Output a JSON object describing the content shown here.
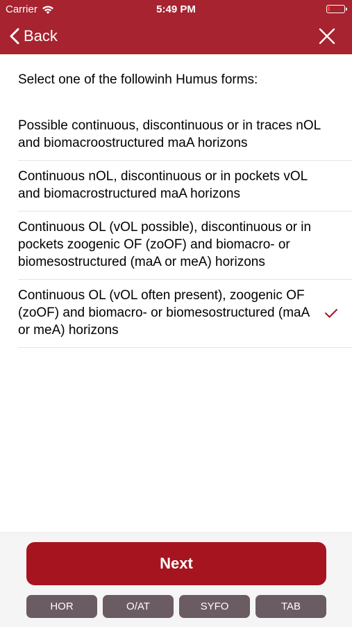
{
  "status_bar": {
    "carrier": "Carrier",
    "time": "5:49 PM",
    "battery_color": "#ff3b30"
  },
  "nav": {
    "back_label": "Back",
    "back_icon": "chevron-left-icon",
    "close_icon": "close-icon",
    "bar_color": "#a6232f"
  },
  "prompt": "Select one of the followinh Humus forms:",
  "options": [
    {
      "label": "Possible continuous, discontinuous or in traces nOL and biomacroostructured maA horizons",
      "selected": false
    },
    {
      "label": "Continuous nOL, discontinuous or in pockets vOL and biomacrostructured maA horizons",
      "selected": false
    },
    {
      "label": "Continuous OL (vOL possible), discontinuous or in pockets zoogenic OF (zoOF) and biomacro- or biomesostructured (maA or meA) horizons",
      "selected": false
    },
    {
      "label": "Continuous OL (vOL often present), zoogenic OF (zoOF) and biomacro- or biomesostructured (maA or meA) horizons",
      "selected": true
    }
  ],
  "next_label": "Next",
  "tabs": [
    "HOR",
    "O/AT",
    "SYFO",
    "TAB"
  ],
  "colors": {
    "accent": "#a6141f",
    "tab_bg": "#6b5b63",
    "check": "#a6141f"
  }
}
